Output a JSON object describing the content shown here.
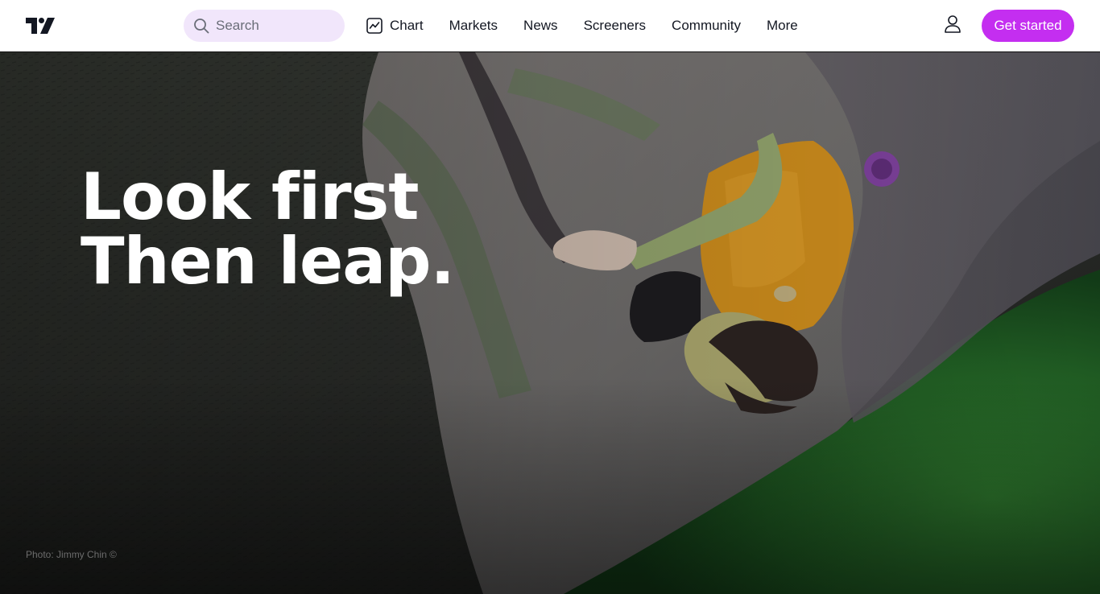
{
  "header": {
    "logo": "TradingView logo",
    "search": {
      "placeholder": "Search",
      "value": "",
      "icon": "search-icon"
    },
    "nav": [
      {
        "label": "Chart",
        "icon": "chart-icon"
      },
      {
        "label": "Markets"
      },
      {
        "label": "News"
      },
      {
        "label": "Screeners"
      },
      {
        "label": "Community"
      },
      {
        "label": "More"
      }
    ],
    "user_icon": "user-icon",
    "cta_label": "Get started"
  },
  "hero": {
    "headline_line1": "Look first",
    "headline_line2": "Then leap.",
    "photo_credit": "Photo: Jimmy Chin ©"
  },
  "colors": {
    "accent": "#c42ef0",
    "search_bg": "#f1e6fb",
    "header_bg": "#ffffff",
    "headline": "#ffffff"
  }
}
